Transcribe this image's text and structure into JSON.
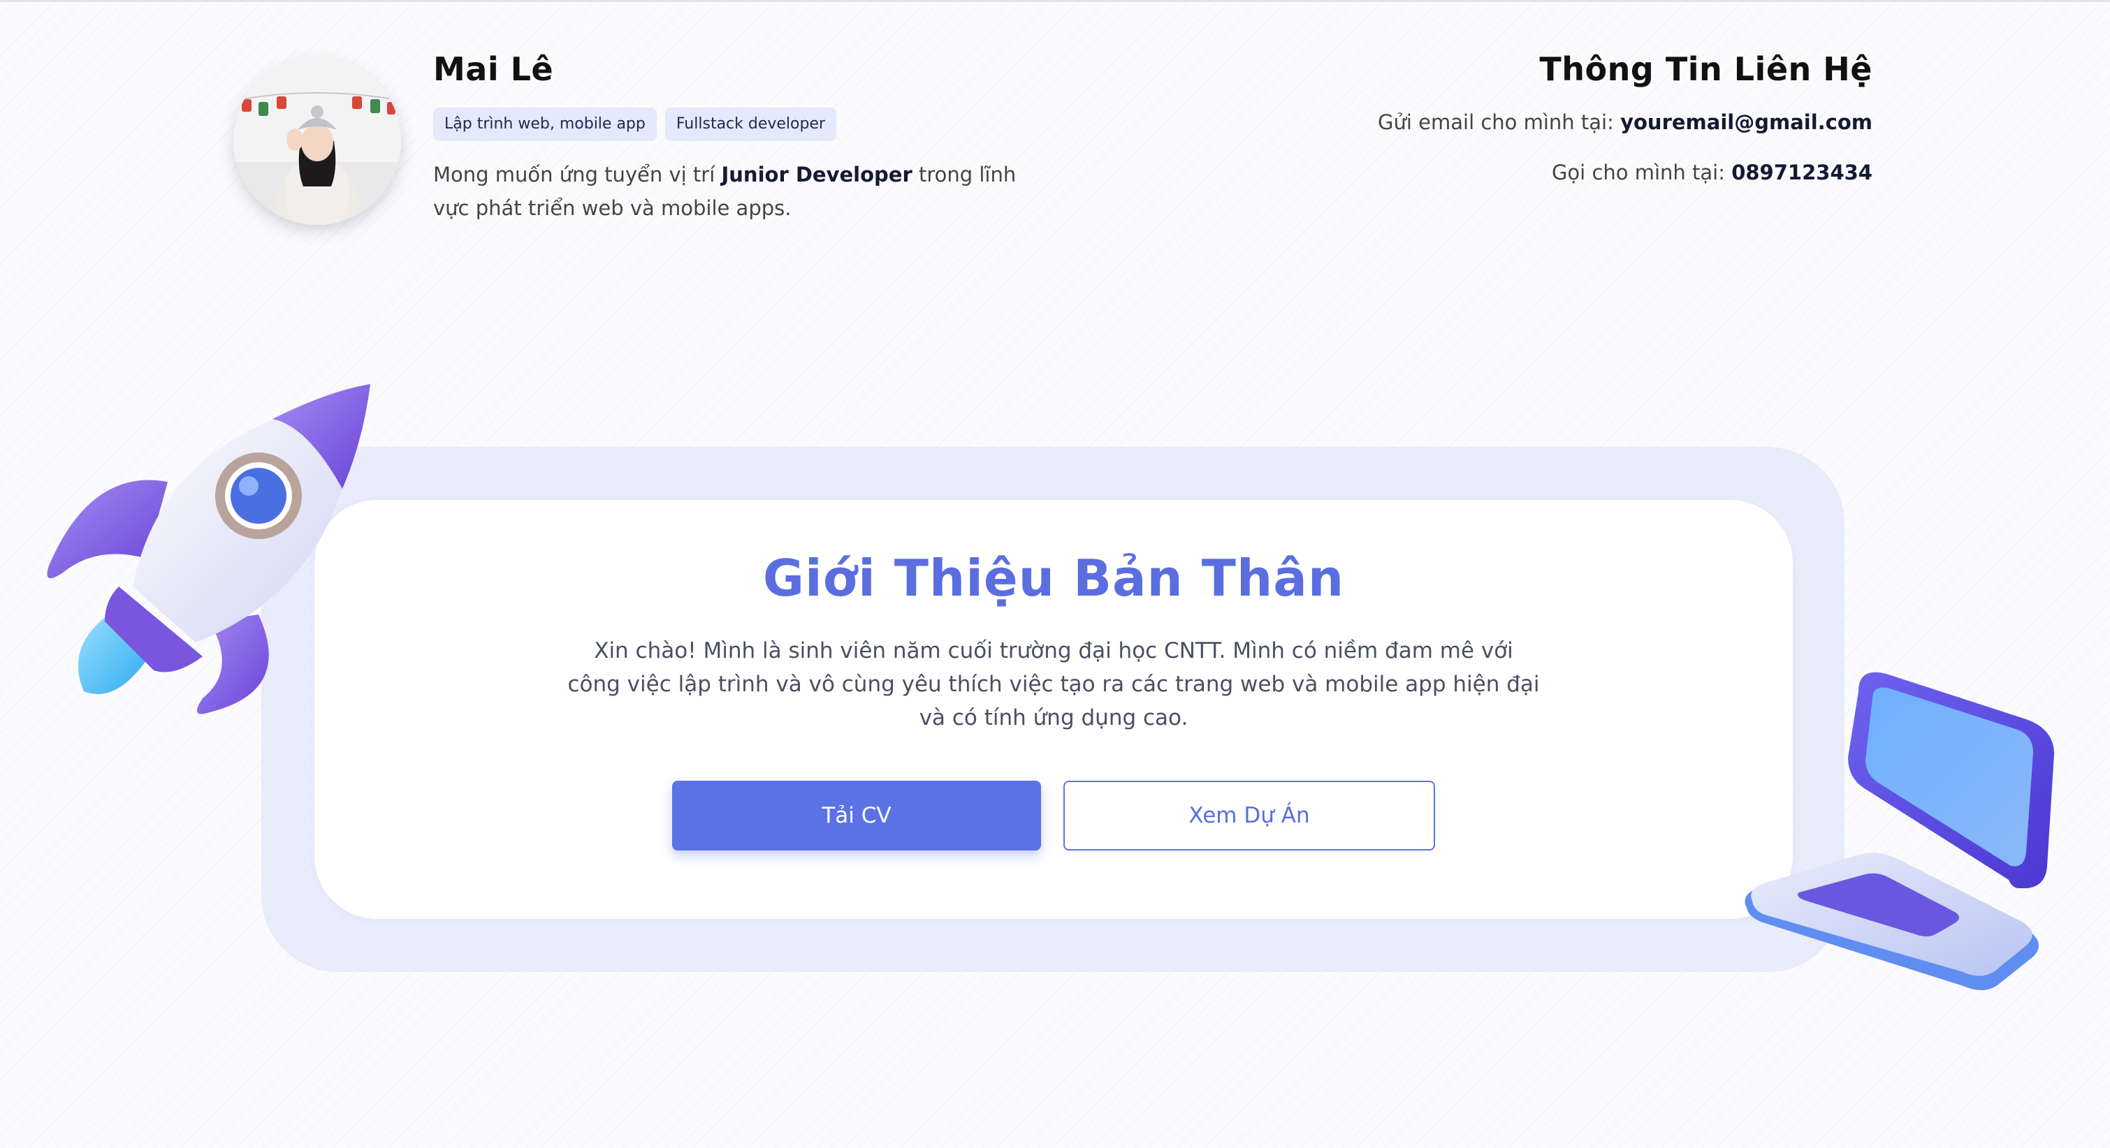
{
  "header": {
    "name": "Mai Lê",
    "tags": [
      "Lập trình web, mobile app",
      "Fullstack developer"
    ],
    "summary_prefix": "Mong muốn ứng tuyển vị trí ",
    "summary_role": "Junior Developer",
    "summary_suffix": " trong lĩnh vực phát triển web và mobile apps."
  },
  "contact": {
    "title": "Thông Tin Liên Hệ",
    "email_label": "Gửi email cho mình tại: ",
    "email": "youremail@gmail.com",
    "phone_label": "Gọi cho mình tại: ",
    "phone": "0897123434"
  },
  "hero": {
    "title": "Giới Thiệu Bản Thân",
    "text": "Xin chào! Mình là sinh viên năm cuối trường đại học CNTT. Mình có niềm đam mê với công việc lập trình và vô cùng yêu thích việc tạo ra các trang web và mobile app hiện đại và có tính ứng dụng cao.",
    "download_button": "Tải CV",
    "projects_button": "Xem Dự Án"
  },
  "icons": {
    "avatar": "avatar-photo",
    "rocket": "rocket-illustration",
    "laptop": "laptop-illustration"
  },
  "colors": {
    "accent": "#5b72e5",
    "title": "#5a6ee0",
    "tag_bg": "#e4e9fb"
  }
}
